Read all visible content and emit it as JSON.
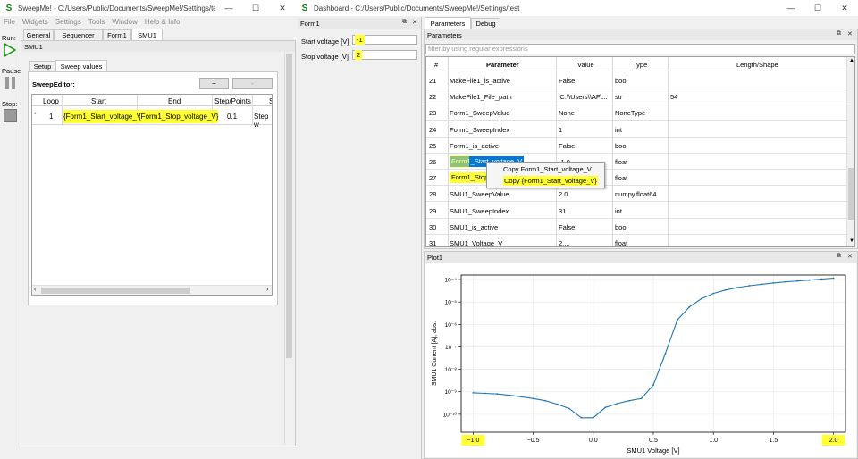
{
  "left_window": {
    "title": "SweepMe! - C:/Users/Public/Documents/SweepMe!/Settings/test.s...",
    "menu": [
      "File",
      "Widgets",
      "Settings",
      "Tools",
      "Window",
      "Help & Info"
    ],
    "run_label": "Run:",
    "pause_label": "Pause:",
    "stop_label": "Stop:",
    "tabs": [
      "General",
      "Sequencer",
      "Form1",
      "SMU1"
    ],
    "module_title": "SMU1",
    "subtabs": [
      "Setup",
      "Sweep values"
    ],
    "sweep_editor_label": "SweepEditor:",
    "add_btn": "+",
    "remove_btn": "-",
    "table_headers": [
      "Loop",
      "Start",
      "End",
      "Step/Points",
      "S"
    ],
    "table_row": {
      "marker": "*",
      "loop": "1",
      "start": "{Form1_Start_voltage_V}",
      "end": "{Form1_Stop_voltage_V}",
      "step": "0.1",
      "s": "Step w"
    }
  },
  "dashboard": {
    "title": "Dashboard - C:/Users/Public/Documents/SweepMe!/Settings/test",
    "form": {
      "title": "Form1",
      "start_label": "Start voltage [V]",
      "start_value": "-1",
      "stop_label": "Stop voltage [V]",
      "stop_value": "2"
    },
    "tabs": [
      "Parameters",
      "Debug"
    ],
    "params_title": "Parameters",
    "filter_placeholder": "filter by using regular expressions",
    "param_headers": [
      "#",
      "Parameter",
      "Value",
      "Type",
      "Length/Shape"
    ],
    "params": [
      {
        "n": "21",
        "p": "MakeFile1_is_active",
        "v": "False",
        "t": "bool",
        "l": ""
      },
      {
        "n": "22",
        "p": "MakeFile1_File_path",
        "v": "'C:\\\\Users\\\\AF\\...",
        "t": "str",
        "l": "54"
      },
      {
        "n": "23",
        "p": "Form1_SweepValue",
        "v": "None",
        "t": "NoneType",
        "l": ""
      },
      {
        "n": "24",
        "p": "Form1_SweepIndex",
        "v": "1",
        "t": "int",
        "l": ""
      },
      {
        "n": "25",
        "p": "Form1_is_active",
        "v": "False",
        "t": "bool",
        "l": ""
      },
      {
        "n": "26",
        "p": "Form1_Start_voltage_V",
        "v": "-1.0",
        "t": "float",
        "l": ""
      },
      {
        "n": "27",
        "p": "Form1_Stop_voltage_V",
        "v": "2.0",
        "t": "float",
        "l": ""
      },
      {
        "n": "28",
        "p": "SMU1_SweepValue",
        "v": "2.0",
        "t": "numpy.float64",
        "l": ""
      },
      {
        "n": "29",
        "p": "SMU1_SweepIndex",
        "v": "31",
        "t": "int",
        "l": ""
      },
      {
        "n": "30",
        "p": "SMU1_is_active",
        "v": "False",
        "t": "bool",
        "l": ""
      },
      {
        "n": "31",
        "p": "SMU1_Voltage_V",
        "v": "2....",
        "t": "float",
        "l": ""
      }
    ],
    "context_menu": [
      "Copy Form1_Start_voltage_V",
      "Copy {Form1_Start_voltage_V}"
    ],
    "plot_title": "Plot1"
  },
  "chart_data": {
    "type": "line",
    "xlabel": "SMU1 Voltage [V]",
    "ylabel": "SMU1 Current [A], abs.",
    "xlim": [
      -1.1,
      2.1
    ],
    "ylim_log10": [
      -10.8,
      -3.8
    ],
    "yscale": "log",
    "x_ticks": [
      "−1.0",
      "−0.5",
      "0.0",
      "0.5",
      "1.0",
      "1.5",
      "2.0"
    ],
    "y_ticks": [
      "10⁻¹⁰",
      "10⁻⁹",
      "10⁻⁸",
      "10⁻⁷",
      "10⁻⁶",
      "10⁻⁵",
      "10⁻⁴"
    ],
    "grid": true,
    "color": "#1f77b4",
    "series": [
      {
        "x": [
          -1.0,
          -0.9,
          -0.8,
          -0.7,
          -0.6,
          -0.5,
          -0.4,
          -0.3,
          -0.2,
          -0.1,
          0.0,
          0.1,
          0.2,
          0.3,
          0.4,
          0.5,
          0.6,
          0.7,
          0.8,
          0.9,
          1.0,
          1.1,
          1.2,
          1.3,
          1.4,
          1.5,
          1.6,
          1.7,
          1.8,
          1.9,
          2.0
        ],
        "y": [
          9e-10,
          8.5e-10,
          8e-10,
          7e-10,
          6e-10,
          5e-10,
          4e-10,
          2.8e-10,
          1.8e-10,
          7e-11,
          7e-11,
          2e-10,
          3e-10,
          4e-10,
          5e-10,
          2e-09,
          5e-08,
          1.6e-06,
          6e-06,
          1.4e-05,
          2.4e-05,
          3.4e-05,
          4.4e-05,
          5.3e-05,
          6.1e-05,
          7e-05,
          7.8e-05,
          8.6e-05,
          9.4e-05,
          0.000105,
          0.000115
        ]
      }
    ]
  }
}
